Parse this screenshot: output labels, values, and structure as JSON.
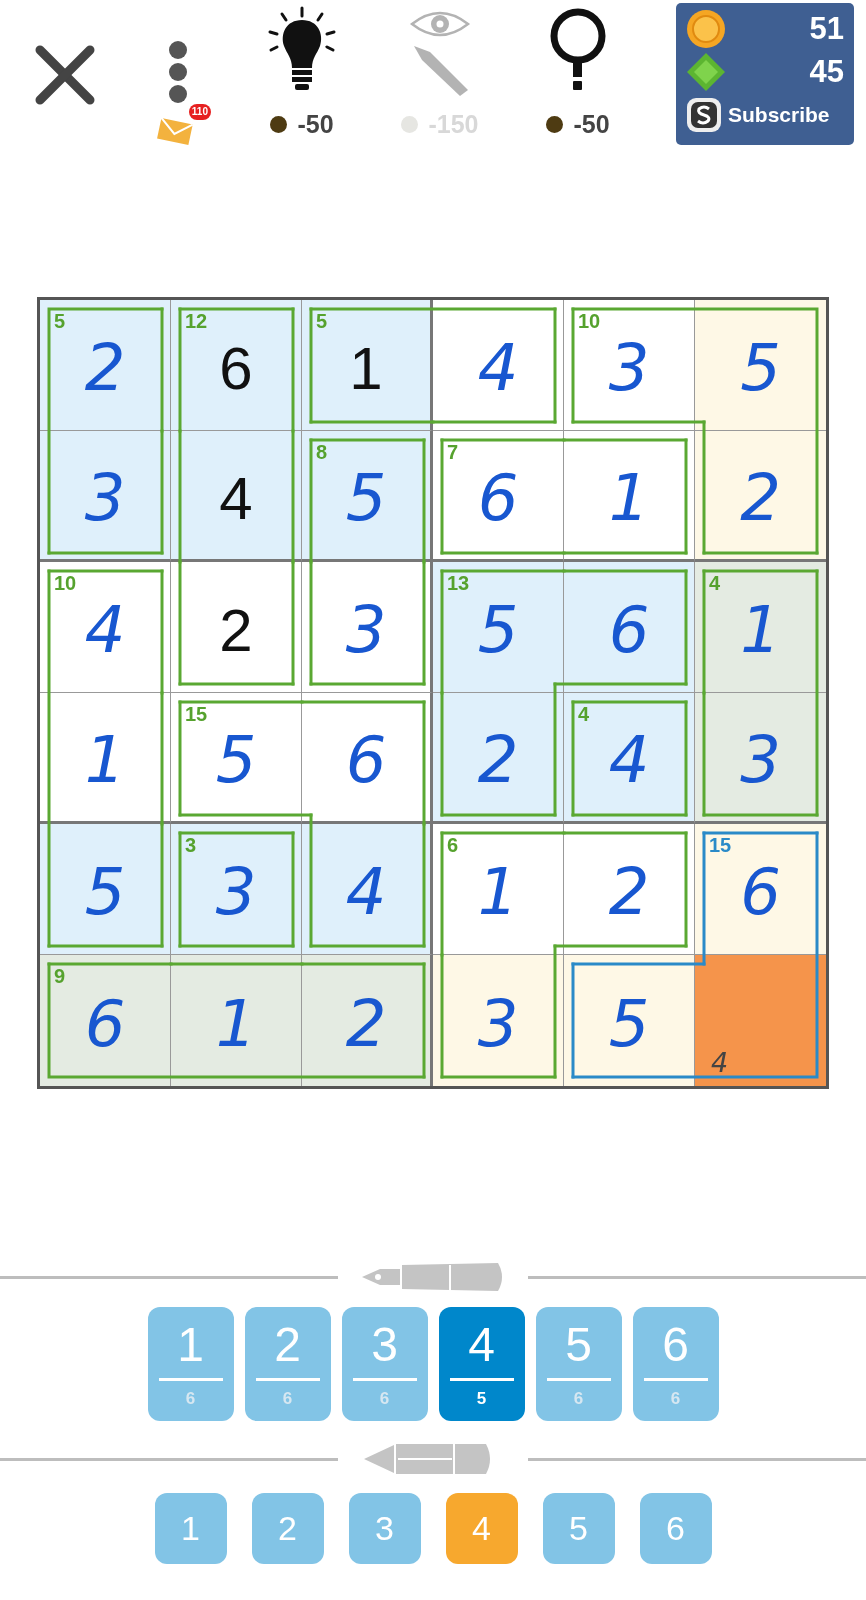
{
  "header": {
    "mail_badge": "110",
    "tools": [
      {
        "kind": "bulb",
        "cost": "-50",
        "disabled": false
      },
      {
        "kind": "eye-pencil",
        "cost": "-150",
        "disabled": true
      },
      {
        "kind": "question",
        "cost": "-50",
        "disabled": false
      }
    ],
    "wallet": {
      "coins": "51",
      "gems": "45",
      "subscribe": "Subscribe"
    }
  },
  "grid": [
    [
      {
        "value": "2",
        "given": false,
        "color": "#dff0fb",
        "wall_right": true,
        "wall_below": false,
        "cage": {
          "sum": "5",
          "selected": false
        }
      },
      {
        "value": "6",
        "given": true,
        "color": "#dff0fb",
        "wall_right": true,
        "wall_below": false,
        "cage": {
          "sum": "12",
          "selected": false
        }
      },
      {
        "value": "1",
        "given": true,
        "color": "#dff0fb",
        "wall_right": false,
        "wall_below": true,
        "cage": {
          "sum": "5",
          "selected": false
        }
      },
      {
        "value": "4",
        "given": false,
        "color": "#ffffff",
        "wall_right": true,
        "wall_below": true
      },
      {
        "value": "3",
        "given": false,
        "color": "#ffffff",
        "wall_right": false,
        "wall_below": true,
        "cage": {
          "sum": "10",
          "selected": false
        }
      },
      {
        "value": "5",
        "given": false,
        "color": "#fef8e6",
        "wall_below": false
      }
    ],
    [
      {
        "value": "3",
        "given": false,
        "color": "#dff0fb",
        "wall_right": true,
        "wall_below": true
      },
      {
        "value": "4",
        "given": true,
        "color": "#dff0fb",
        "wall_right": true,
        "wall_below": false
      },
      {
        "value": "5",
        "given": false,
        "color": "#dff0fb",
        "wall_right": true,
        "wall_below": false,
        "cage": {
          "sum": "8",
          "selected": false
        }
      },
      {
        "value": "6",
        "given": false,
        "color": "#ffffff",
        "wall_right": false,
        "wall_below": true,
        "cage": {
          "sum": "7",
          "selected": false
        }
      },
      {
        "value": "1",
        "given": false,
        "color": "#ffffff",
        "wall_right": true,
        "wall_below": true
      },
      {
        "value": "2",
        "given": false,
        "color": "#fef8e6",
        "wall_below": true
      }
    ],
    [
      {
        "value": "4",
        "given": false,
        "color": "#ffffff",
        "wall_right": true,
        "wall_below": false,
        "cage": {
          "sum": "10",
          "selected": false
        }
      },
      {
        "value": "2",
        "given": true,
        "color": "#ffffff",
        "wall_right": true,
        "wall_below": true
      },
      {
        "value": "3",
        "given": false,
        "color": "#ffffff",
        "wall_right": true,
        "wall_below": true
      },
      {
        "value": "5",
        "given": false,
        "color": "#dff0fb",
        "wall_right": false,
        "wall_below": false,
        "cage": {
          "sum": "13",
          "selected": false
        }
      },
      {
        "value": "6",
        "given": false,
        "color": "#dff0fb",
        "wall_right": true,
        "wall_below": true
      },
      {
        "value": "1",
        "given": false,
        "color": "#e4ebe2",
        "wall_below": false,
        "cage": {
          "sum": "4",
          "selected": false
        }
      }
    ],
    [
      {
        "value": "1",
        "given": false,
        "color": "#ffffff",
        "wall_right": true,
        "wall_below": false
      },
      {
        "value": "5",
        "given": false,
        "color": "#ffffff",
        "wall_right": false,
        "wall_below": true,
        "cage": {
          "sum": "15",
          "selected": false
        }
      },
      {
        "value": "6",
        "given": false,
        "color": "#ffffff",
        "wall_right": true,
        "wall_below": false
      },
      {
        "value": "2",
        "given": false,
        "color": "#dff0fb",
        "wall_right": true,
        "wall_below": true
      },
      {
        "value": "4",
        "given": false,
        "color": "#dff0fb",
        "wall_right": true,
        "wall_below": true,
        "cage": {
          "sum": "4",
          "selected": false
        }
      },
      {
        "value": "3",
        "given": false,
        "color": "#e4ebe2",
        "wall_below": true
      }
    ],
    [
      {
        "value": "5",
        "given": false,
        "color": "#dff0fb",
        "wall_right": true,
        "wall_below": true
      },
      {
        "value": "3",
        "given": false,
        "color": "#dff0fb",
        "wall_right": true,
        "wall_below": true,
        "cage": {
          "sum": "3",
          "selected": false
        }
      },
      {
        "value": "4",
        "given": false,
        "color": "#dff0fb",
        "wall_right": true,
        "wall_below": true
      },
      {
        "value": "1",
        "given": false,
        "color": "#ffffff",
        "wall_right": false,
        "wall_below": false,
        "cage": {
          "sum": "6",
          "selected": false
        }
      },
      {
        "value": "2",
        "given": false,
        "color": "#ffffff",
        "wall_right": true,
        "wall_below": true
      },
      {
        "value": "6",
        "given": false,
        "color": "#fef8e6",
        "wall_below": false,
        "cage": {
          "sum": "15",
          "selected": true
        }
      }
    ],
    [
      {
        "value": "6",
        "given": false,
        "color": "#e4ebe2",
        "wall_right": false,
        "cage": {
          "sum": "9",
          "selected": false
        }
      },
      {
        "value": "1",
        "given": false,
        "color": "#e4ebe2",
        "wall_right": false
      },
      {
        "value": "2",
        "given": false,
        "color": "#e4ebe2",
        "wall_right": true
      },
      {
        "value": "3",
        "given": false,
        "color": "#fef8e6",
        "wall_right": true
      },
      {
        "value": "5",
        "given": false,
        "color": "#fef8e6",
        "wall_right": false
      },
      {
        "notes": [
          "4"
        ],
        "color": "#f5944b"
      }
    ]
  ],
  "pen_keys": [
    {
      "digit": "1",
      "count": "6",
      "selected": false
    },
    {
      "digit": "2",
      "count": "6",
      "selected": false
    },
    {
      "digit": "3",
      "count": "6",
      "selected": false
    },
    {
      "digit": "4",
      "count": "5",
      "selected": true
    },
    {
      "digit": "5",
      "count": "6",
      "selected": false
    },
    {
      "digit": "6",
      "count": "6",
      "selected": false
    }
  ],
  "pencil_keys": [
    {
      "digit": "1",
      "selected": false
    },
    {
      "digit": "2",
      "selected": false
    },
    {
      "digit": "3",
      "selected": false
    },
    {
      "digit": "4",
      "selected": true
    },
    {
      "digit": "5",
      "selected": false
    },
    {
      "digit": "6",
      "selected": false
    }
  ]
}
